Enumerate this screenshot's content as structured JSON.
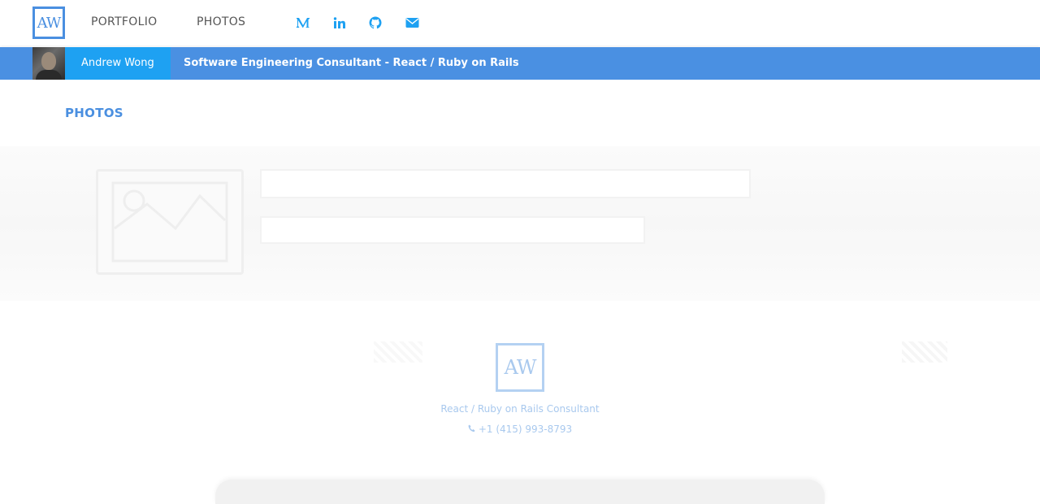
{
  "nav": {
    "logo_text": "AW",
    "links": {
      "portfolio": "PORTFOLIO",
      "photos": "PHOTOS"
    },
    "social_icons": [
      "medium-icon",
      "linkedin-icon",
      "github-icon",
      "email-icon"
    ],
    "icon_color": "#1ea1f2"
  },
  "banner": {
    "name": "Andrew Wong",
    "title": "Software Engineering Consultant - React / Ruby on Rails",
    "color": "#4a90e2",
    "name_color": "#1ea1f2"
  },
  "main": {
    "heading": "PHOTOS",
    "state": "loading-placeholder"
  },
  "footer": {
    "logo_text": "AW",
    "tagline": "React / Ruby on Rails Consultant",
    "phone": "+1 (415) 993-8793"
  }
}
